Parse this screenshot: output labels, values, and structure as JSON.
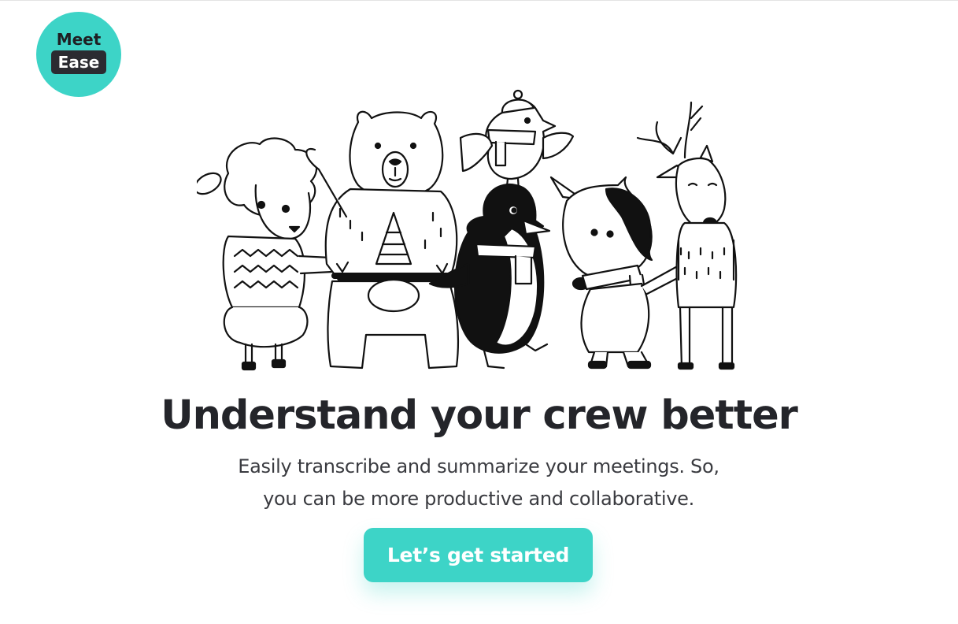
{
  "colors": {
    "accent": "#3dd4c7"
  },
  "logo": {
    "line1": "Meet",
    "line2": "Ease"
  },
  "hero": {
    "illustration": "animal-crew-sketch",
    "headline": "Understand your crew better",
    "subtitle_line1": "Easily transcribe and summarize your meetings. So,",
    "subtitle_line2": "you can be more productive and collaborative.",
    "cta_label": "Let’s get started"
  }
}
